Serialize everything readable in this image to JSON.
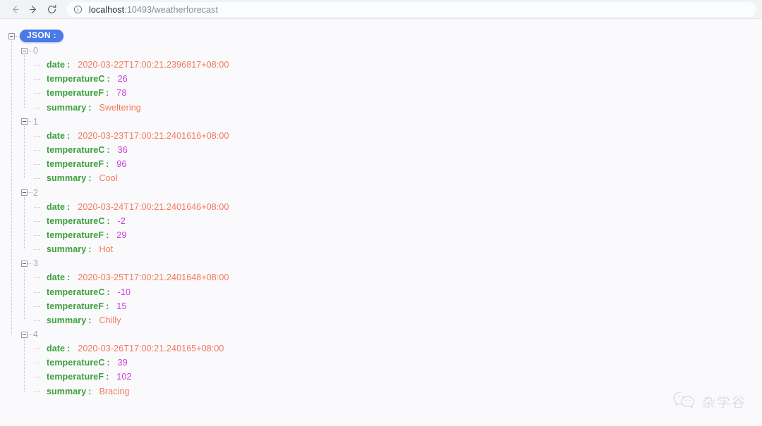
{
  "browser": {
    "back_label": "Back",
    "forward_label": "Forward",
    "reload_label": "Reload",
    "url_host": "localhost",
    "url_rest": ":10493/weatherforecast",
    "url_full": "localhost:10493/weatherforecast",
    "site_info_label": "View site information"
  },
  "viewer": {
    "root_label": "JSON :",
    "root_badge_color": "#4a7ae8",
    "key_color": "#3aa13a",
    "string_color": "#f4795b",
    "number_color": "#c940d8",
    "index_color": "#a9a9b2",
    "background_color": "#faf9fc"
  },
  "json": {
    "items": [
      {
        "index": "0",
        "fields": [
          {
            "key": "date",
            "value": "2020-03-22T17:00:21.2396817+08:00",
            "type": "string"
          },
          {
            "key": "temperatureC",
            "value": "26",
            "type": "number"
          },
          {
            "key": "temperatureF",
            "value": "78",
            "type": "number"
          },
          {
            "key": "summary",
            "value": "Sweltering",
            "type": "string"
          }
        ]
      },
      {
        "index": "1",
        "fields": [
          {
            "key": "date",
            "value": "2020-03-23T17:00:21.2401616+08:00",
            "type": "string"
          },
          {
            "key": "temperatureC",
            "value": "36",
            "type": "number"
          },
          {
            "key": "temperatureF",
            "value": "96",
            "type": "number"
          },
          {
            "key": "summary",
            "value": "Cool",
            "type": "string"
          }
        ]
      },
      {
        "index": "2",
        "fields": [
          {
            "key": "date",
            "value": "2020-03-24T17:00:21.2401646+08:00",
            "type": "string"
          },
          {
            "key": "temperatureC",
            "value": "-2",
            "type": "number"
          },
          {
            "key": "temperatureF",
            "value": "29",
            "type": "number"
          },
          {
            "key": "summary",
            "value": "Hot",
            "type": "string"
          }
        ]
      },
      {
        "index": "3",
        "fields": [
          {
            "key": "date",
            "value": "2020-03-25T17:00:21.2401648+08:00",
            "type": "string"
          },
          {
            "key": "temperatureC",
            "value": "-10",
            "type": "number"
          },
          {
            "key": "temperatureF",
            "value": "15",
            "type": "number"
          },
          {
            "key": "summary",
            "value": "Chilly",
            "type": "string"
          }
        ]
      },
      {
        "index": "4",
        "fields": [
          {
            "key": "date",
            "value": "2020-03-26T17:00:21.240165+08:00",
            "type": "string"
          },
          {
            "key": "temperatureC",
            "value": "39",
            "type": "number"
          },
          {
            "key": "temperatureF",
            "value": "102",
            "type": "number"
          },
          {
            "key": "summary",
            "value": "Bracing",
            "type": "string"
          }
        ]
      }
    ]
  },
  "watermark": {
    "text": "杂学谷",
    "icon": "wechat-icon"
  }
}
